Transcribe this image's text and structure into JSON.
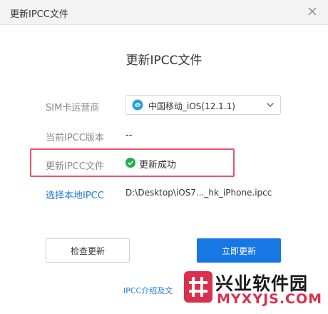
{
  "window": {
    "title": "更新IPCC文件"
  },
  "heading": "更新IPCC文件",
  "carrier": {
    "label": "SIM卡运营商",
    "selected": "中国移动_iOS(12.1.1)"
  },
  "current_version": {
    "label": "当前IPCC版本",
    "value": "--"
  },
  "update_file": {
    "label": "更新IPCC文件",
    "status": "更新成功"
  },
  "local_file": {
    "link": "选择本地IPCC",
    "path": "D:\\Desktop\\iOS7..._hk_iPhone.ipcc"
  },
  "buttons": {
    "check": "检查更新",
    "update": "立即更新"
  },
  "intro_link": "IPCC介绍及文",
  "watermark": {
    "cn": "兴业软件园",
    "en": "MYXYJS.COM"
  },
  "colors": {
    "accent": "#1677e5",
    "link": "#1f7ad8",
    "highlight": "#e8546a",
    "success": "#1fb050",
    "carrier_icon": "#2aa0d8"
  }
}
